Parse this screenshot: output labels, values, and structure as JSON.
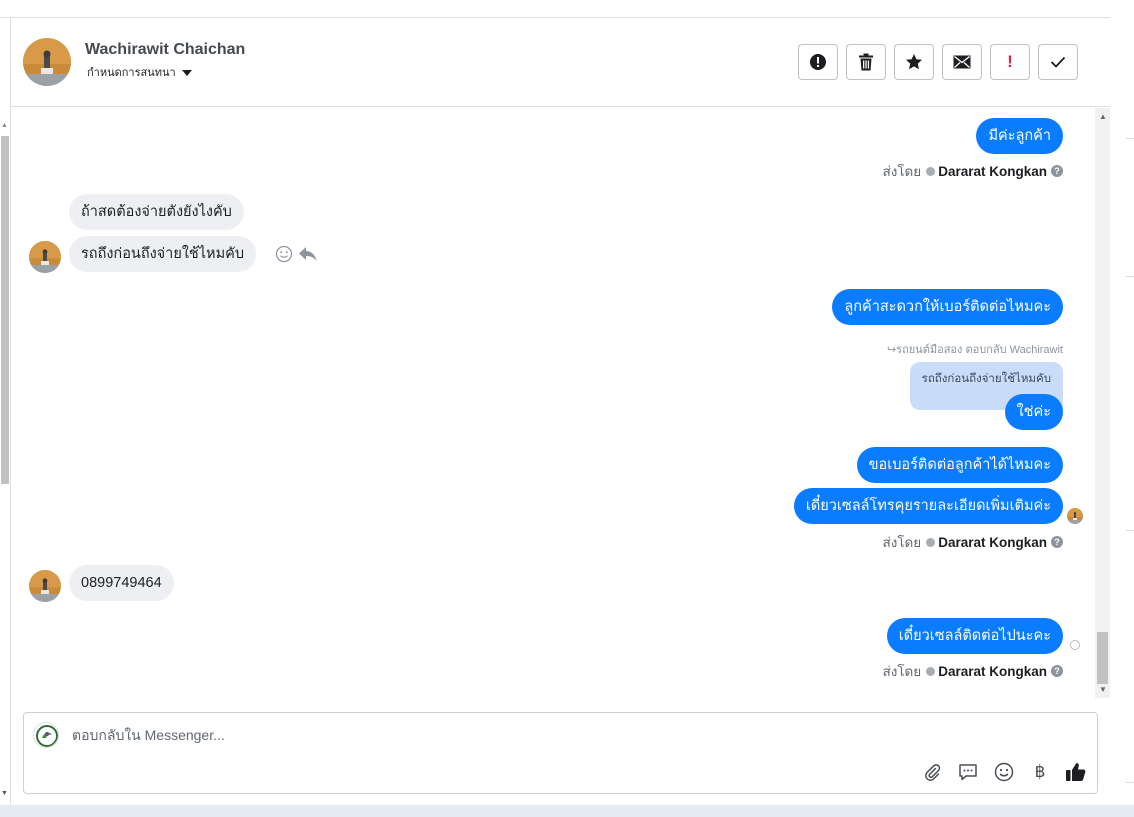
{
  "header": {
    "name": "Wachirawit Chaichan",
    "subtitle": "กำหนดการสนทนา",
    "actions": [
      {
        "name": "mark-spam-button",
        "icon": "alert-circle-icon"
      },
      {
        "name": "delete-button",
        "icon": "trash-icon"
      },
      {
        "name": "star-button",
        "icon": "star-icon"
      },
      {
        "name": "mark-unread-button",
        "icon": "envelope-icon"
      },
      {
        "name": "follow-up-button",
        "label": "!"
      },
      {
        "name": "mark-done-button",
        "icon": "check-icon"
      }
    ]
  },
  "messages": {
    "m1": "มีค่ะลูกค้า",
    "sent_by_prefix": "ส่งโดย",
    "sent_by_agent": "Dararat Kongkan",
    "in1": "ถ้าสดต้องจ่ายตังยังไงคับ",
    "in2": "รถถึงก่อนถึงจ่ายใช้ไหมคับ",
    "m2": "ลูกค้าสะดวกให้เบอร์ติดต่อไหมคะ",
    "reply_meta": "รถยนต์มือสอง ตอบกลับ Wachirawit",
    "reply_quote": "รถถึงก่อนถึงจ่ายใช้ไหมคับ",
    "m3": "ใช่ค่ะ",
    "m4": "ขอเบอร์ติดต่อลูกค้าได้ไหมคะ",
    "m5": "เดี๋ยวเซลล์โทรคุยรายละเอียดเพิ่มเติมค่ะ",
    "in3": "0899749464",
    "m6": "เดี๋ยวเซลล์ติดต่อไปนะคะ"
  },
  "composer": {
    "placeholder": "ตอบกลับใน Messenger...",
    "tools": [
      "paperclip-icon",
      "saved-replies-icon",
      "emoji-icon",
      "baht-icon",
      "thumbs-up-icon"
    ],
    "baht_symbol": "฿"
  },
  "colors": {
    "outgoing_bubble": "#0a7cff",
    "incoming_bubble": "#eeeff2",
    "reply_quote": "#c9dcf9",
    "follow_up_red": "#e41e3f"
  }
}
